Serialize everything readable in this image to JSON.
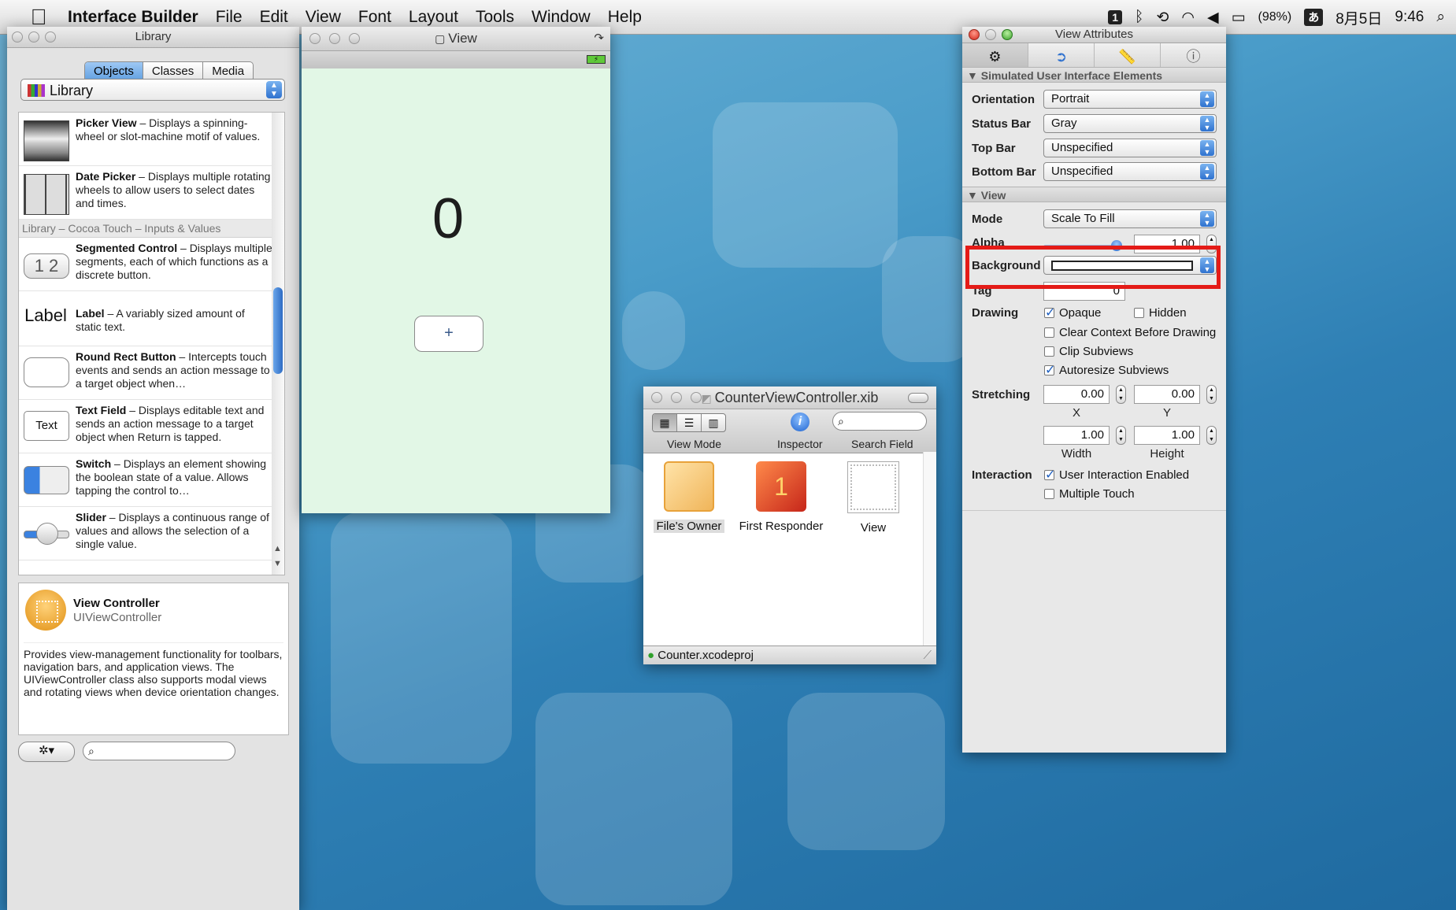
{
  "menubar": {
    "app": "Interface Builder",
    "items": [
      "File",
      "Edit",
      "View",
      "Font",
      "Layout",
      "Tools",
      "Window",
      "Help"
    ],
    "battery": "(98%)",
    "date": "8月5日",
    "time": "9:46",
    "input_method": "あ"
  },
  "library": {
    "title": "Library",
    "tabs": [
      "Objects",
      "Classes",
      "Media"
    ],
    "selector": "Library",
    "items": [
      {
        "name": "Picker View",
        "desc": " – Displays a spinning-wheel or slot-machine motif of values."
      },
      {
        "name": "Date Picker",
        "desc": " – Displays multiple rotating wheels to allow users to select dates and times."
      }
    ],
    "section": "Library – Cocoa Touch – Inputs & Values",
    "items2": [
      {
        "name": "Segmented Control",
        "desc": " – Displays multiple segments, each of which functions as a discrete button.",
        "icon_text": "1 2"
      },
      {
        "name": "Label",
        "desc": " – A variably sized amount of static text.",
        "icon_text": "Label"
      },
      {
        "name": "Round Rect Button",
        "desc": " – Intercepts touch events and sends an action message to a target object when…"
      },
      {
        "name": "Text Field",
        "desc": " – Displays editable text and sends an action message to a target object when Return is tapped.",
        "icon_text": "Text"
      },
      {
        "name": "Switch",
        "desc": " – Displays an element showing the boolean state of a value. Allows tapping the control to…"
      },
      {
        "name": "Slider",
        "desc": " – Displays a continuous range of values and allows the selection of a single value."
      }
    ],
    "detail": {
      "name": "View Controller",
      "class": "UIViewController",
      "desc": "Provides view-management functionality for toolbars, navigation bars, and application views. The UIViewController class also supports modal views and rotating views when device orientation changes."
    },
    "search_placeholder": ""
  },
  "view_window": {
    "title": "View",
    "counter": "0",
    "button": "+"
  },
  "xib_window": {
    "title": "CounterViewController.xib",
    "toolbar": {
      "view_mode": "View Mode",
      "inspector": "Inspector",
      "search": "Search Field"
    },
    "objects": [
      "File's Owner",
      "First Responder",
      "View"
    ],
    "footer": "Counter.xcodeproj"
  },
  "attributes": {
    "title": "View Attributes",
    "section1": "Simulated User Interface Elements",
    "orientation_label": "Orientation",
    "orientation": "Portrait",
    "statusbar_label": "Status Bar",
    "statusbar": "Gray",
    "topbar_label": "Top Bar",
    "topbar": "Unspecified",
    "bottombar_label": "Bottom Bar",
    "bottombar": "Unspecified",
    "section2": "View",
    "mode_label": "Mode",
    "mode": "Scale To Fill",
    "alpha_label": "Alpha",
    "alpha": "1.00",
    "background_label": "Background",
    "tag_label": "Tag",
    "tag": "0",
    "drawing_label": "Drawing",
    "opaque": "Opaque",
    "hidden": "Hidden",
    "clear_context": "Clear Context Before Drawing",
    "clip_subviews": "Clip Subviews",
    "autoresize": "Autoresize Subviews",
    "stretching_label": "Stretching",
    "stretch_x": "0.00",
    "stretch_y": "0.00",
    "x_label": "X",
    "y_label": "Y",
    "stretch_w": "1.00",
    "stretch_h": "1.00",
    "w_label": "Width",
    "h_label": "Height",
    "interaction_label": "Interaction",
    "user_interaction": "User Interaction Enabled",
    "multiple_touch": "Multiple Touch"
  },
  "colors": {
    "highlight": "#e41b17",
    "canvas": "#e2f7e6"
  }
}
